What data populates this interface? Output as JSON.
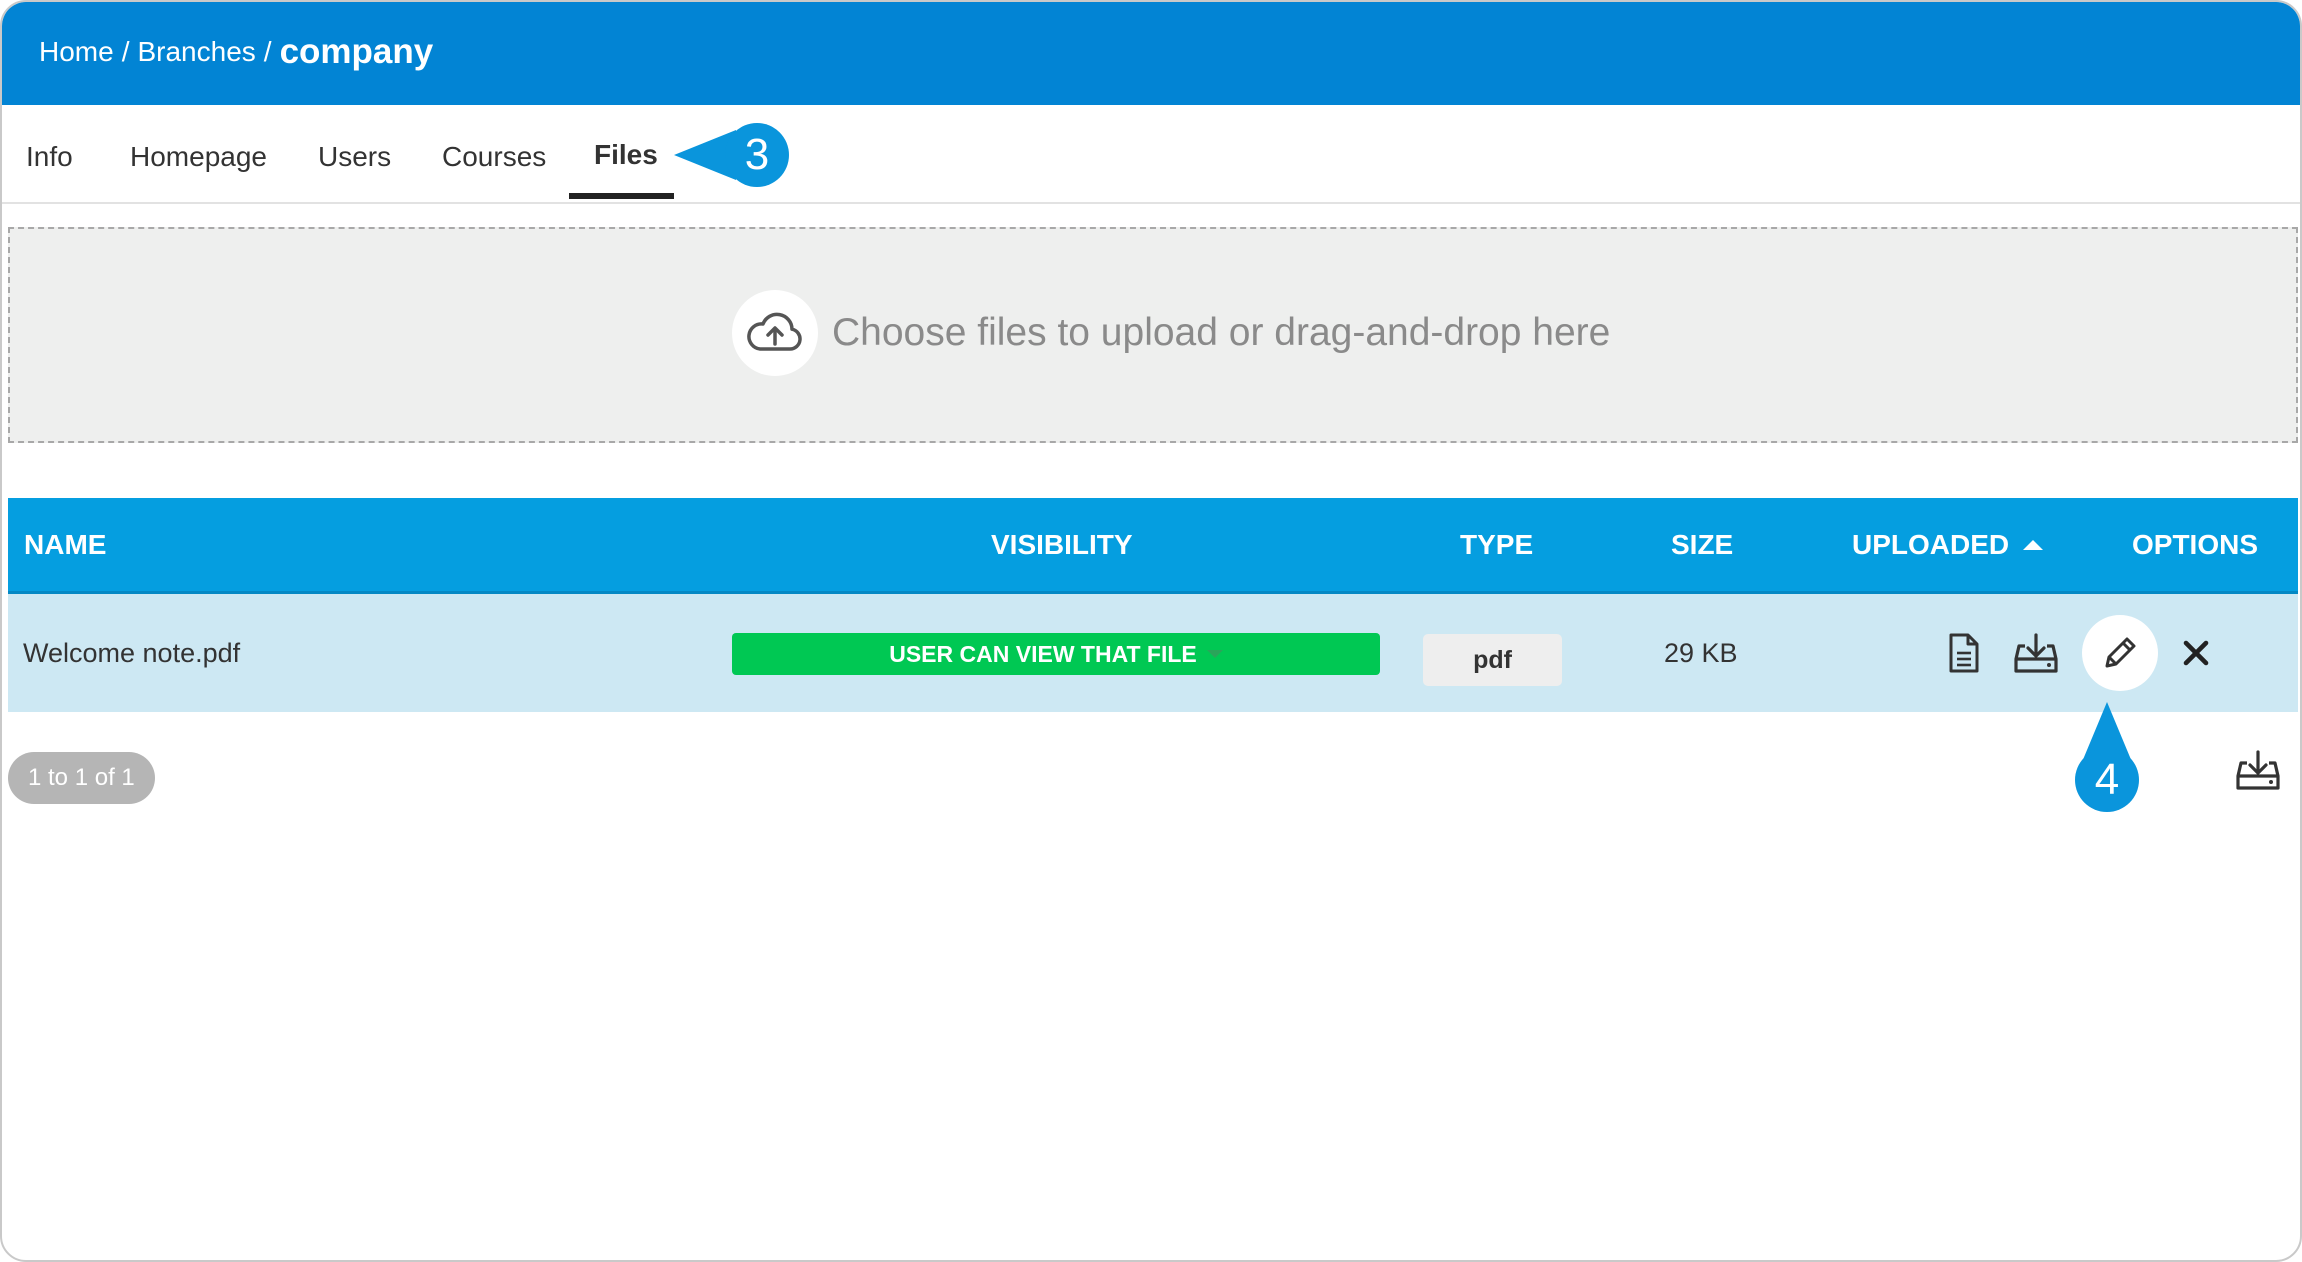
{
  "breadcrumb": {
    "home": "Home",
    "branches": "Branches",
    "current": "company",
    "separator": "/"
  },
  "tabs": [
    {
      "label": "Info"
    },
    {
      "label": "Homepage"
    },
    {
      "label": "Users"
    },
    {
      "label": "Courses"
    },
    {
      "label": "Files",
      "active": true
    }
  ],
  "callouts": {
    "tabs": "3",
    "edit": "4"
  },
  "upload": {
    "text": "Choose files to upload or drag-and-drop here",
    "icon": "cloud-upload-icon"
  },
  "table": {
    "headers": {
      "name": "NAME",
      "visibility": "VISIBILITY",
      "type": "TYPE",
      "size": "SIZE",
      "uploaded": "UPLOADED",
      "options": "OPTIONS"
    },
    "sort": {
      "column": "uploaded",
      "direction": "ascending"
    },
    "rows": [
      {
        "name": "Welcome note.pdf",
        "visibility": "USER CAN VIEW THAT FILE",
        "type": "pdf",
        "size": "29 KB",
        "options": [
          "file-preview-icon",
          "download-icon",
          "edit-pencil-icon",
          "delete-x-icon"
        ]
      }
    ]
  },
  "pagination": {
    "text": "1 to 1 of 1"
  },
  "colors": {
    "header": "#0284d4",
    "table_header": "#059ee0",
    "row": "#cde8f3",
    "visibility_pill": "#00c853",
    "callout": "#0a95dc"
  }
}
